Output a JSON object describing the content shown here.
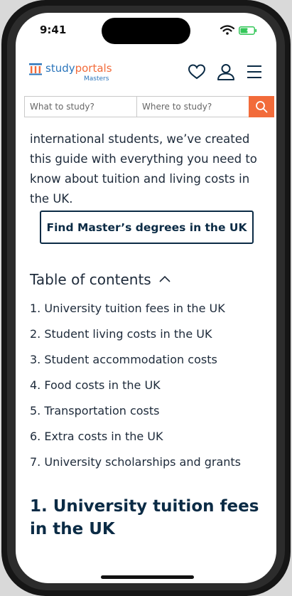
{
  "status_bar": {
    "time": "9:41"
  },
  "header": {
    "logo_prefix": "study",
    "logo_accent": "portals",
    "logo_sub": "Masters"
  },
  "search": {
    "what_placeholder": "What to study?",
    "where_placeholder": "Where to study?"
  },
  "content": {
    "intro": "international students, we’ve created this guide with everything you need to know about tuition and living costs in the UK.",
    "cta_label": "Find Master’s degrees in the UK",
    "toc_title": "Table of contents",
    "toc_items": [
      "1. University tuition fees in the UK",
      "2. Student living costs in the UK",
      "3. Student accommodation costs",
      "4. Food costs in the UK",
      "5. Transportation costs",
      "6. Extra costs in the UK",
      "7. University scholarships and grants"
    ],
    "section_title": "1. University tuition fees in the UK"
  },
  "colors": {
    "brand_blue": "#2b75bb",
    "accent_orange": "#f26b3a",
    "navy": "#0b2b45",
    "battery_green": "#34c759"
  },
  "icons": [
    "wifi-icon",
    "battery-icon",
    "heart-icon",
    "user-icon",
    "menu-icon",
    "search-icon",
    "chevron-up-icon"
  ]
}
